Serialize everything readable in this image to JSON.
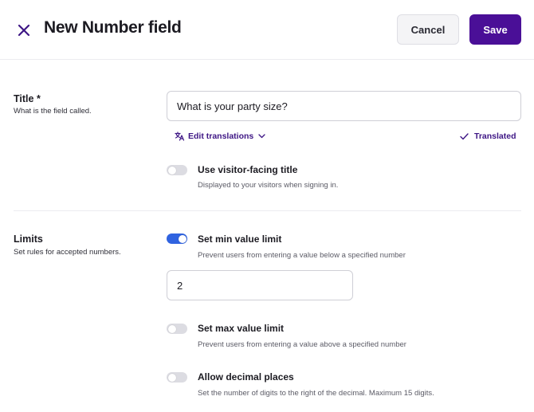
{
  "header": {
    "title": "New Number field",
    "cancel_label": "Cancel",
    "save_label": "Save"
  },
  "title_section": {
    "label": "Title *",
    "help": "What is the field called.",
    "input_value": "What is your party size?",
    "edit_translations_label": "Edit translations",
    "translated_label": "Translated",
    "visitor_title": {
      "label": "Use visitor-facing title",
      "help": "Displayed to your visitors when signing in.",
      "enabled": false
    }
  },
  "limits_section": {
    "label": "Limits",
    "help": "Set rules for accepted numbers.",
    "min_limit": {
      "label": "Set min value limit",
      "help": "Prevent users from entering a value below a specified number",
      "enabled": true,
      "value": "2"
    },
    "max_limit": {
      "label": "Set max value limit",
      "help": "Prevent users from entering a value above a specified number",
      "enabled": false
    },
    "decimal_places": {
      "label": "Allow decimal places",
      "help": "Set the number of digits to the right of the decimal. Maximum 15 digits.",
      "enabled": false
    }
  },
  "colors": {
    "primary": "#4a0f97",
    "toggle_on": "#3063e0",
    "toggle_off": "#dcdce2",
    "link": "#3e1685"
  }
}
